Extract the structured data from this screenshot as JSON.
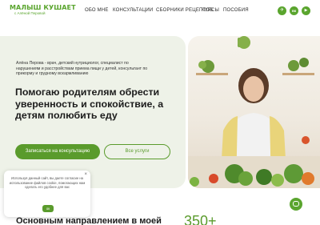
{
  "logo": {
    "main": "МАЛЫШ КУШАЕТ",
    "sub": "с Алёной Перовой"
  },
  "nav": {
    "items": [
      {
        "label": "ОБО МНЕ"
      },
      {
        "label": "КОНСУЛЬТАЦИИ"
      },
      {
        "label": "СБОРНИКИ РЕЦЕПТОВ"
      },
      {
        "label": "КУРСЫ"
      },
      {
        "label": "ПОСОБИЯ"
      }
    ]
  },
  "socials": [
    {
      "icon": "telegram-icon",
      "glyph": "✈"
    },
    {
      "icon": "vk-icon",
      "glyph": "вк"
    },
    {
      "icon": "youtube-icon",
      "glyph": "▶"
    }
  ],
  "hero": {
    "intro": "Алёна Перова - врач, детский нутрициолог, специалист по нарушениям и расстройствам приема пищи у детей, консультант по прикорму и грудному вскармливанию",
    "headline": "Помогаю родителям обрести уверенность и спокойствие, а детям полюбить еду",
    "primary_button": "Записаться на консультацию",
    "secondary_button": "Все услуги"
  },
  "cookie": {
    "text": "Используя данный сайт, вы даете согласие на использование файлов cookie, помогающих нам сделать его удобнее для вас",
    "ok": "ок",
    "close": "×"
  },
  "section": {
    "title": "Основным направлением в моей",
    "number": "350+"
  },
  "colors": {
    "accent": "#5a9b2c",
    "hero_bg": "#eef2e8"
  }
}
